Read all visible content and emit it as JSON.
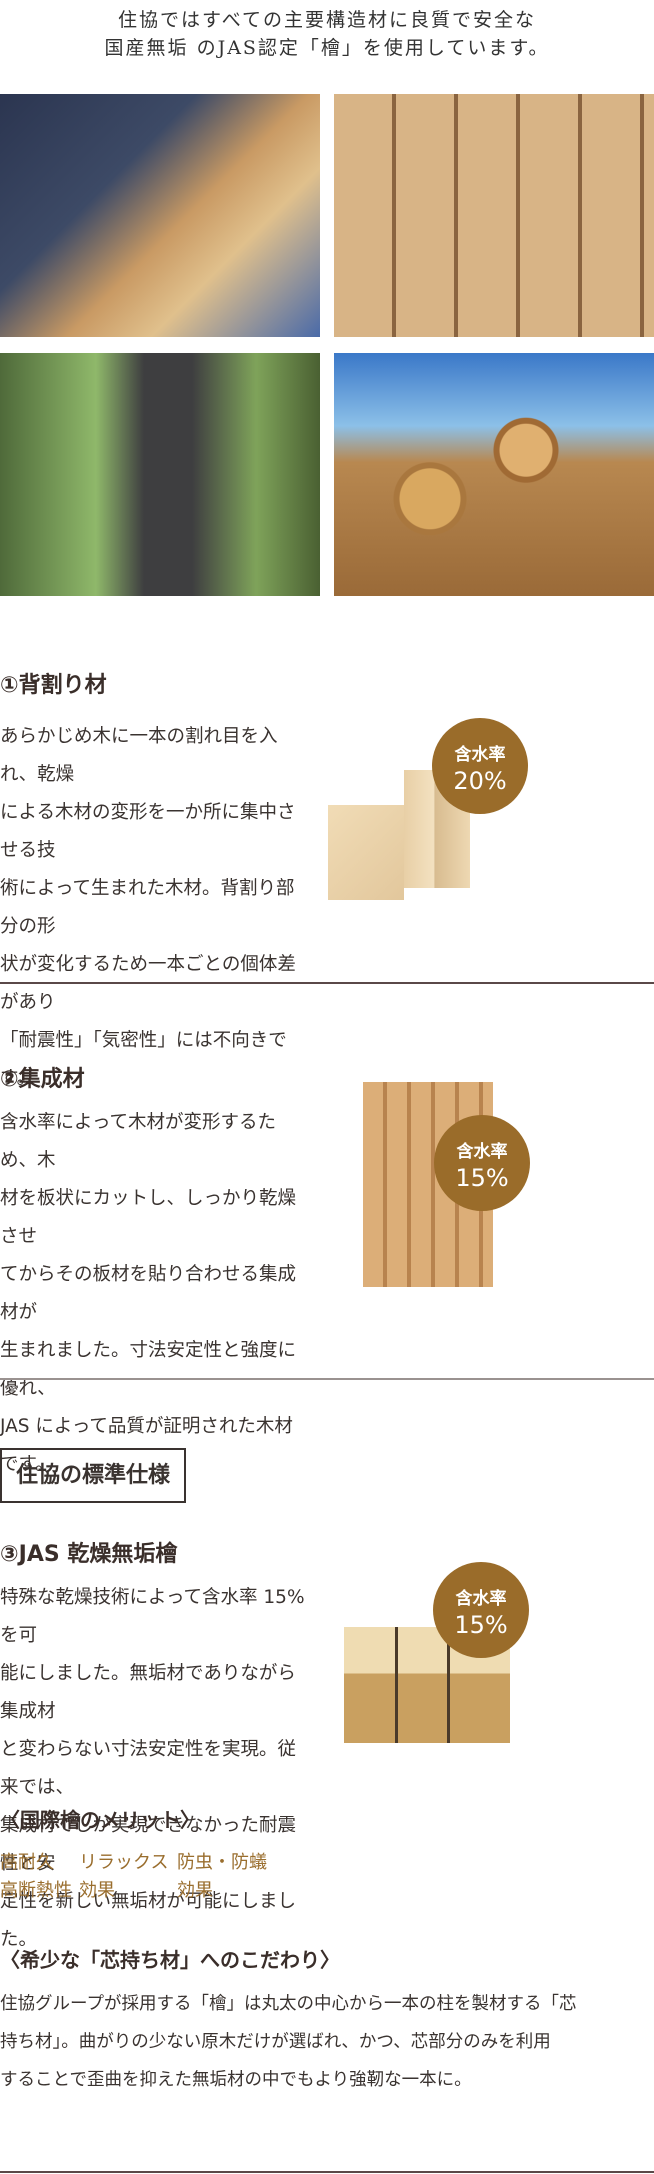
{
  "intro": {
    "line1": "住協ではすべての主要構造材に良質で安全な",
    "line2": "国産無垢 のJAS認定「檜」を使用しています。"
  },
  "photos": [
    "factory-worker-photo",
    "lumber-stack-photo",
    "forester-chainsaw-photo",
    "log-pile-photo"
  ],
  "sections": [
    {
      "title": "①背割り材",
      "lines": [
        "あらかじめ木に一本の割れ目を入れ、乾燥",
        "による木材の変形を一か所に集中させる技",
        "術によって生まれた木材。背割り部分の形",
        "状が変化するため一本ごとの個体差があり",
        "「耐震性」「気密性」には不向きです。"
      ],
      "badge_label": "含水率",
      "badge_value": "20%"
    },
    {
      "title": "②集成材",
      "lines": [
        "含水率によって木材が変形するため、木",
        "材を板状にカットし、しっかり乾燥させ",
        "てからその板材を貼り合わせる集成材が",
        "生まれました。寸法安定性と強度に優れ、",
        "JAS によって品質が証明された木材です。"
      ],
      "badge_label": "含水率",
      "badge_value": "15%"
    },
    {
      "title": "③JAS 乾燥無垢檜",
      "lines": [
        "特殊な乾燥技術によって含水率 15%を可",
        "能にしました。無垢材でありながら集成材",
        "と変わらない寸法安定性を実現。従来では、",
        "集成材でしか実現できなかった耐震性と安",
        "定性を新しい無垢材が可能にしました。"
      ],
      "badge_label": "含水率",
      "badge_value": "15%"
    }
  ],
  "standard_box": "住協の標準仕様",
  "merit": {
    "title": "〈国際檜のメリット〉",
    "items": [
      [
        "高耐久",
        "高断熱性"
      ],
      [
        "リラックス",
        "効果"
      ],
      [
        "防虫・防蟻",
        "効果"
      ]
    ]
  },
  "kodawari": {
    "title": "〈希少な「芯持ち材」へのこだわり〉",
    "lines": [
      "住協グループが採用する「檜」は丸太の中心から一本の柱を製材する「芯",
      "持ち材」。曲がりの少ない原木だけが選ばれ、かつ、芯部分のみを利用",
      "することで歪曲を抑えた無垢材の中でもより強靭な一本に。"
    ]
  },
  "colors": {
    "accent": "#9a6c2a",
    "text": "#3a3330",
    "divider": "#5a4848"
  }
}
